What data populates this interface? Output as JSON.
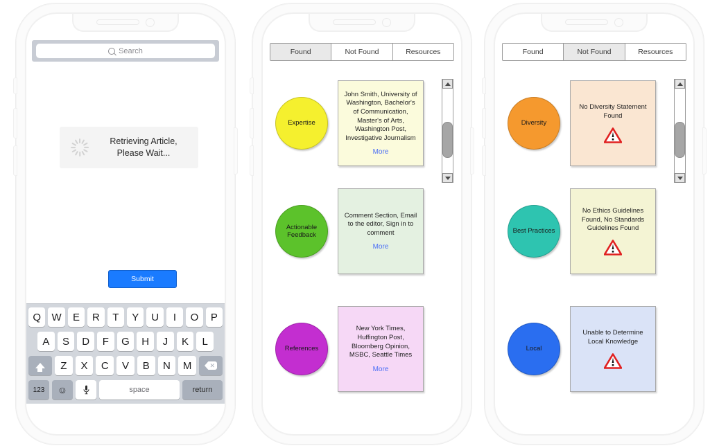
{
  "phone1": {
    "search": {
      "placeholder": "Search",
      "icon": "search-icon"
    },
    "loading": {
      "line1": "Retrieving Article,",
      "line2": "Please Wait..."
    },
    "submit_label": "Submit",
    "keyboard": {
      "row1": [
        "Q",
        "W",
        "E",
        "R",
        "T",
        "Y",
        "U",
        "I",
        "O",
        "P"
      ],
      "row2": [
        "A",
        "S",
        "D",
        "F",
        "G",
        "H",
        "J",
        "K",
        "L"
      ],
      "row3": [
        "Z",
        "X",
        "C",
        "V",
        "B",
        "N",
        "M"
      ],
      "numeric_label": "123",
      "emoji_label": "☺",
      "mic_label": "Ⓖ",
      "space_label": "space",
      "return_label": "return",
      "shift_label": "shift-key",
      "delete_label": "delete-key"
    }
  },
  "phone2": {
    "tabs": [
      {
        "label": "Found",
        "active": true
      },
      {
        "label": "Not Found",
        "active": false
      },
      {
        "label": "Resources",
        "active": false
      }
    ],
    "items": [
      {
        "circle_label": "Expertise",
        "circle_color": "#f5f02e",
        "card_color": "#fbfbdc",
        "card_text": "John Smith, University of Washington, Bachelor's of Communication, Master's of Arts, Washington Post, Investigative Journalism",
        "more_label": "More"
      },
      {
        "circle_label": "Actionable Feedback",
        "circle_color": "#5cc22b",
        "card_color": "#e4f1e1",
        "card_text": "Comment Section, Email to the editor, Sign in to comment",
        "more_label": "More"
      },
      {
        "circle_label": "References",
        "circle_color": "#c32ed0",
        "card_color": "#f6d8f6",
        "card_text": "New York Times, Huffington Post, Bloomberg Opinion, MSBC, Seattle Times",
        "more_label": "More"
      }
    ]
  },
  "phone3": {
    "tabs": [
      {
        "label": "Found",
        "active": false
      },
      {
        "label": "Not Found",
        "active": true
      },
      {
        "label": "Resources",
        "active": false
      }
    ],
    "items": [
      {
        "circle_label": "Diversity",
        "circle_color": "#f5992e",
        "card_color": "#fae6d2",
        "card_text": "No Diversity Statement Found",
        "icon": "warning-triangle-icon"
      },
      {
        "circle_label": "Best Practices",
        "circle_color": "#2ec4b0",
        "card_color": "#f4f4d4",
        "card_text": "No Ethics Guidelines Found, No Standards Guidelines Found",
        "icon": "warning-triangle-icon"
      },
      {
        "circle_label": "Local",
        "circle_color": "#2a6ef0",
        "card_color": "#dae3f7",
        "card_text": "Unable to Determine Local Knowledge",
        "icon": "warning-triangle-icon"
      }
    ]
  },
  "colors": {
    "accent_blue": "#1a7bff",
    "link_blue": "#4a6ef5",
    "keyboard_bg": "#d2d6dc"
  }
}
